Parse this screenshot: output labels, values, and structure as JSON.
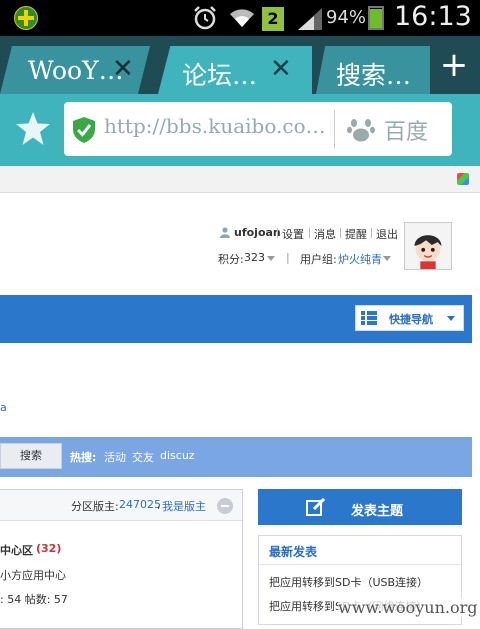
{
  "status_bar": {
    "sim_slot": "2",
    "battery_percent": "94%",
    "battery_level": 0.94,
    "time": "16:13",
    "icons": [
      "app-notification-icon",
      "alarm-icon",
      "wifi-icon",
      "sim-icon",
      "signal-icon",
      "battery-icon"
    ]
  },
  "browser": {
    "tabs": [
      {
        "label": "WooY…",
        "close": "✕",
        "active": false
      },
      {
        "label": "论坛…",
        "close": "✕",
        "active": true
      },
      {
        "label": "搜索…",
        "active": false
      }
    ],
    "new_tab": "+",
    "url": "http://bbs.kuaibo.co…",
    "search_engine": "百度",
    "colors": {
      "chrome_dark": "#1f4b55",
      "chrome_accent": "#3fb4bd"
    }
  },
  "user": {
    "username": "ufojoan",
    "settings": "设置",
    "messages": "消息",
    "reminders": "提醒",
    "logout": "退出",
    "points_label": "积分:",
    "points_value": "323",
    "separator": "|",
    "group_label": "用户组:",
    "group_value": "炉火纯青"
  },
  "quick_nav": {
    "label": "快捷导航"
  },
  "link_fragment": "a",
  "search": {
    "button": "搜索",
    "hot_label": "热搜:",
    "hot_items": [
      "活动",
      "交友",
      "discuz"
    ]
  },
  "forum": {
    "moderators_label": "分区版主:",
    "moderator_id": "247025",
    "comma": ",",
    "apply": "我是版主",
    "name": "中心区",
    "count": "(32)",
    "description": "小方应用中心",
    "stats": ": 54   帖数: 57"
  },
  "post_button": {
    "label": "发表主题"
  },
  "latest": {
    "title": "最新发表",
    "items": [
      "把应用转移到SD卡（USB连接）",
      "把应用转移到SD卡（网络连接）"
    ]
  },
  "watermark": "www.wooyun.org",
  "theme": {
    "primary_blue": "#2b77cc",
    "link_blue": "#2b6fc0",
    "search_bar": "#7aa6e3"
  }
}
